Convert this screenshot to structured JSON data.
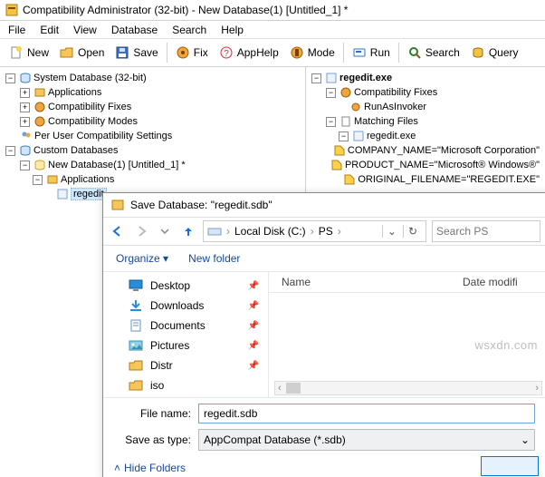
{
  "window": {
    "title": "Compatibility Administrator (32-bit) - New Database(1) [Untitled_1] *"
  },
  "menu": {
    "file": "File",
    "edit": "Edit",
    "view": "View",
    "database": "Database",
    "search": "Search",
    "help": "Help"
  },
  "toolbar": {
    "new": "New",
    "open": "Open",
    "save": "Save",
    "fix": "Fix",
    "apphelp": "AppHelp",
    "mode": "Mode",
    "run": "Run",
    "search": "Search",
    "query": "Query"
  },
  "left_tree": {
    "system_db": "System Database (32-bit)",
    "apps": "Applications",
    "compat_fixes": "Compatibility Fixes",
    "compat_modes": "Compatibility Modes",
    "per_user": "Per User Compatibility Settings",
    "custom_db": "Custom Databases",
    "new_db": "New Database(1) [Untitled_1] *",
    "new_db_apps": "Applications",
    "regedit": "regedit"
  },
  "right_tree": {
    "exe": "regedit.exe",
    "compat_fixes": "Compatibility Fixes",
    "runas": "RunAsInvoker",
    "matching": "Matching Files",
    "match_exe": "regedit.exe",
    "attr1": "COMPANY_NAME=\"Microsoft Corporation\"",
    "attr2": "PRODUCT_NAME=\"Microsoft® Windows®\"",
    "attr3": "ORIGINAL_FILENAME=\"REGEDIT.EXE\""
  },
  "dialog": {
    "title": "Save Database: \"regedit.sdb\"",
    "crumbs": {
      "disk": "Local Disk (C:)",
      "folder": "PS"
    },
    "refresh": "↻",
    "search_placeholder": "Search PS",
    "organize": "Organize ▾",
    "newfolder": "New folder",
    "col_name": "Name",
    "col_date": "Date modifi",
    "places": {
      "desktop": "Desktop",
      "downloads": "Downloads",
      "documents": "Documents",
      "pictures": "Pictures",
      "distr": "Distr",
      "iso": "iso"
    },
    "file_label": "File name:",
    "file_value": "regedit.sdb",
    "type_label": "Save as type:",
    "type_value": "AppCompat Database (*.sdb)",
    "hide": "Hide Folders"
  },
  "watermark": "wsxdn.com"
}
